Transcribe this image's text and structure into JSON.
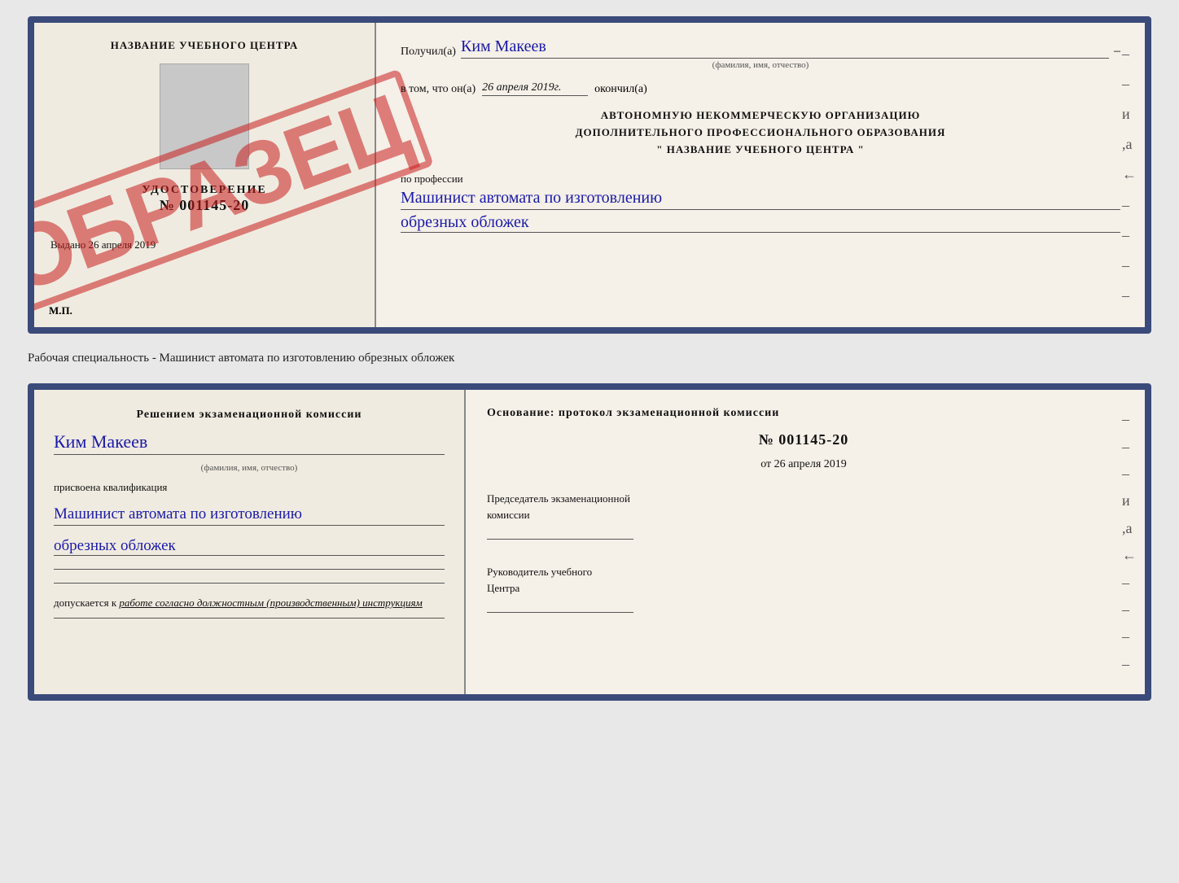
{
  "top_document": {
    "left": {
      "school_title": "НАЗВАНИЕ УЧЕБНОГО ЦЕНТРА",
      "udostoverenie_label": "УДОСТОВЕРЕНИЕ",
      "udostoverenie_num": "№ 001145-20",
      "vudano_text": "Выдано",
      "vudano_date": "26 апреля 2019",
      "mp_label": "М.П.",
      "stamp_text": "ОБРАЗЕЦ"
    },
    "right": {
      "poluchil_label": "Получил(а)",
      "poluchil_name": "Ким Макеев",
      "fio_hint": "(фамилия, имя, отчество)",
      "vtom_label": "в том, что он(а)",
      "vtom_date": "26 апреля 2019г.",
      "okonchil_label": "окончил(а)",
      "org_line1": "АВТОНОМНУЮ НЕКОММЕРЧЕСКУЮ ОРГАНИЗАЦИЮ",
      "org_line2": "ДОПОЛНИТЕЛЬНОГО ПРОФЕССИОНАЛЬНОГО ОБРАЗОВАНИЯ",
      "org_line3": "\"    НАЗВАНИЕ УЧЕБНОГО ЦЕНТРА    \"",
      "po_professii": "по профессии",
      "profession_line1": "Машинист автомата по изготовлению",
      "profession_line2": "обрезных обложек"
    }
  },
  "middle": {
    "text": "Рабочая специальность - Машинист автомата по изготовлению обрезных обложек"
  },
  "bottom_document": {
    "left": {
      "resheniyem_line1": "Решением экзаменационной комиссии",
      "kim_makeev": "Ким Макеев",
      "fio_hint": "(фамилия, имя, отчество)",
      "prisvoena_label": "присвоена квалификация",
      "kval_line1": "Машинист автомата по изготовлению",
      "kval_line2": "обрезных обложек",
      "dopuskaetsya_label": "допускается к",
      "dopuskaetsya_italic": "работе согласно должностным (производственным) инструкциям"
    },
    "right": {
      "osnovanie_text": "Основание: протокол экзаменационной комиссии",
      "protocol_num": "№ 001145-20",
      "ot_prefix": "от",
      "ot_date": "26 апреля 2019",
      "predsedatel_line1": "Председатель экзаменационной",
      "predsedatel_line2": "комиссии",
      "rukovoditel_line1": "Руководитель учебного",
      "rukovoditel_line2": "Центра"
    }
  }
}
